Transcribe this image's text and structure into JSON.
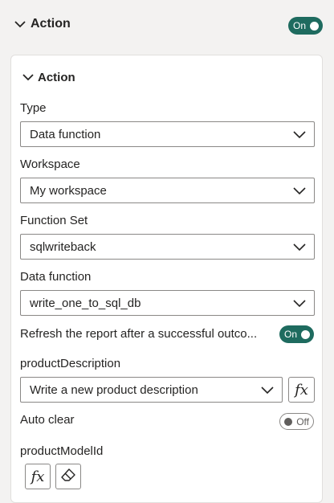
{
  "header": {
    "title": "Action",
    "toggle_label": "On"
  },
  "card": {
    "title": "Action",
    "type": {
      "label": "Type",
      "value": "Data function"
    },
    "workspace": {
      "label": "Workspace",
      "value": "My workspace"
    },
    "function_set": {
      "label": "Function Set",
      "value": "sqlwriteback"
    },
    "data_function": {
      "label": "Data function",
      "value": "write_one_to_sql_db"
    },
    "refresh": {
      "label": "Refresh the report after a successful outco...",
      "toggle_label": "On"
    },
    "product_description": {
      "label": "productDescription",
      "placeholder": "Write a new product description",
      "fx_label": "fx"
    },
    "auto_clear": {
      "label": "Auto clear",
      "toggle_label": "Off"
    },
    "product_model_id": {
      "label": "productModelId",
      "fx_label": "fx"
    }
  },
  "colors": {
    "toggle_on": "#1e6b5f",
    "border": "#8a8886",
    "panel_bg": "#f3f2f1"
  },
  "icons": [
    "chevron-down-icon",
    "caret-down-icon",
    "fx-icon",
    "eraser-icon"
  ]
}
